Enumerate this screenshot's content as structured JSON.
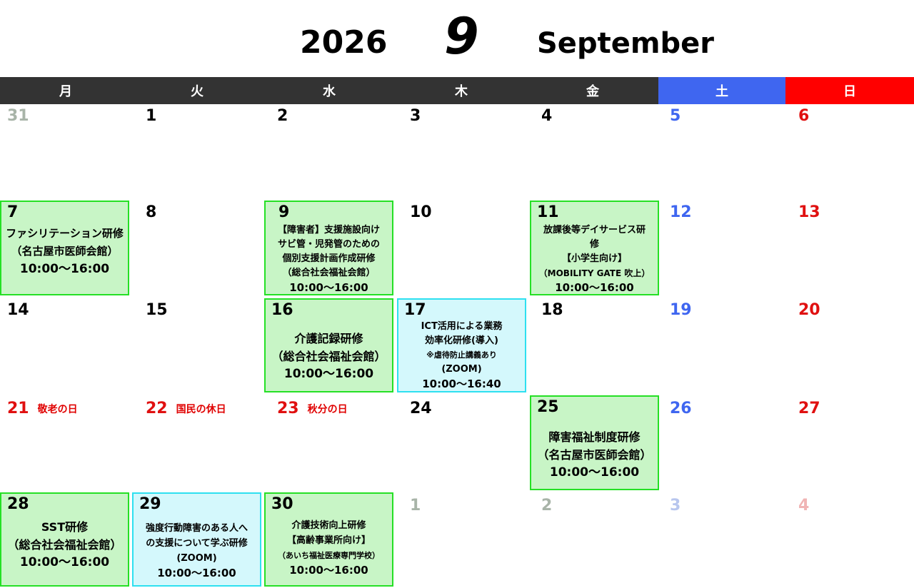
{
  "header": {
    "year": "2026",
    "month_number": "9",
    "month_name": "September"
  },
  "weekdays": [
    {
      "label": "月"
    },
    {
      "label": "火"
    },
    {
      "label": "水"
    },
    {
      "label": "木"
    },
    {
      "label": "金"
    },
    {
      "label": "土"
    },
    {
      "label": "日"
    }
  ],
  "days": {
    "d31": "31",
    "d1": "1",
    "d2": "2",
    "d3": "3",
    "d4": "4",
    "d5": "5",
    "d6": "6",
    "d8": "8",
    "d10": "10",
    "d12": "12",
    "d13": "13",
    "d14": "14",
    "d15": "15",
    "d18": "18",
    "d19": "19",
    "d20": "20",
    "d21": "21",
    "d22": "22",
    "d23": "23",
    "d24": "24",
    "d26": "26",
    "d27": "27",
    "n1": "1",
    "n2": "2",
    "n3": "3",
    "n4": "4"
  },
  "holidays": {
    "h21": "敬老の日",
    "h22": "国民の休日",
    "h23": "秋分の日"
  },
  "events": {
    "e7": {
      "day": "7",
      "lines": [
        "ファシリテーション研修",
        "（名古屋市医師会館）",
        "10:00～16:00"
      ]
    },
    "e9": {
      "day": "9",
      "lines": [
        "【障害者】支援施設向け",
        "サビ管・児発管のための",
        "個別支援計画作成研修",
        "（総合社会福祉会館）",
        "10:00～16:00"
      ]
    },
    "e11": {
      "day": "11",
      "lines": [
        "放課後等デイサービス研",
        "修",
        "【小学生向け】",
        "（MOBILITY GATE 吹上）",
        "10:00～16:00"
      ]
    },
    "e16": {
      "day": "16",
      "lines": [
        "介護記録研修",
        "（総合社会福祉会館）",
        "10:00～16:00"
      ]
    },
    "e17": {
      "day": "17",
      "lines": [
        "ICT活用による業務",
        "効率化研修(導入)",
        "※虐待防止講義あり",
        "(ZOOM)",
        "10:00～16:40"
      ]
    },
    "e25": {
      "day": "25",
      "lines": [
        "障害福祉制度研修",
        "（名古屋市医師会館）",
        "10:00～16:00"
      ]
    },
    "e28": {
      "day": "28",
      "lines": [
        "SST研修",
        "（総合社会福祉会館）",
        "10:00～16:00"
      ]
    },
    "e29": {
      "day": "29",
      "lines": [
        "強度行動障害のある人へ",
        "の支援について学ぶ研修",
        "(ZOOM)",
        "10:00～16:00"
      ]
    },
    "e30": {
      "day": "30",
      "lines": [
        "介護技術向上研修",
        "【高齢事業所向け】",
        "（あいち福祉医療専門学校）",
        "10:00～16:00"
      ]
    }
  },
  "colors": {
    "weekbar": "#333333",
    "saturday": "#3f66f0",
    "sunday": "#ff0000",
    "event_green_bg": "#c8f5c6",
    "event_green_border": "#25e025",
    "event_cyan_bg": "#d4f8fc",
    "event_cyan_border": "#2ee0f0"
  }
}
